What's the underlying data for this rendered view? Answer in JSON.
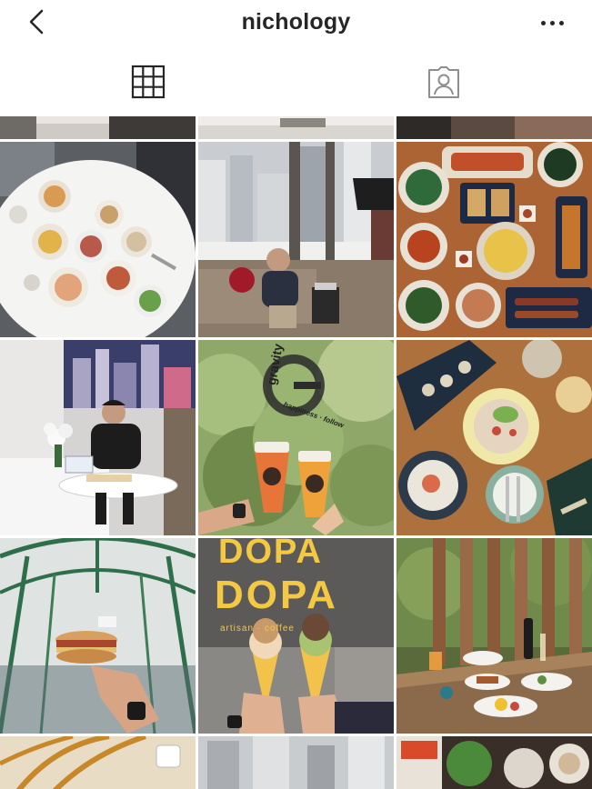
{
  "header": {
    "username": "nichology",
    "back_icon": "chevron-left-icon",
    "more_icon": "ellipsis-icon"
  },
  "tabs": [
    {
      "name": "grid",
      "icon": "grid-icon",
      "active": true
    },
    {
      "name": "tagged",
      "icon": "tagged-person-icon",
      "active": false
    }
  ],
  "posts": {
    "row1": [
      "hotel-breakfast-table",
      "man-at-hotel-window",
      "thai-food-spread"
    ],
    "row2": [
      "man-hotel-room-breakfast",
      "gravity-cafe-drinks",
      "fine-dining-plates"
    ],
    "row3": [
      "burger-under-glass-roof",
      "dopa-ice-cream-cones",
      "outdoor-terrace-dinner"
    ],
    "row4": [
      "hotel-interior-partial",
      "city-view-partial",
      "seafood-platter-partial"
    ]
  },
  "brand_text": {
    "gravity": "gravity",
    "gravity_sub": "happiness · follow",
    "dopa_top": "DOPA",
    "dopa_main": "DOPA",
    "dopa_sub": "artisan · coffee"
  },
  "colors": {
    "text": "#262626",
    "icon_active": "#262626",
    "icon_inactive": "#8e8e8e",
    "divider": "#dbdbdb"
  }
}
